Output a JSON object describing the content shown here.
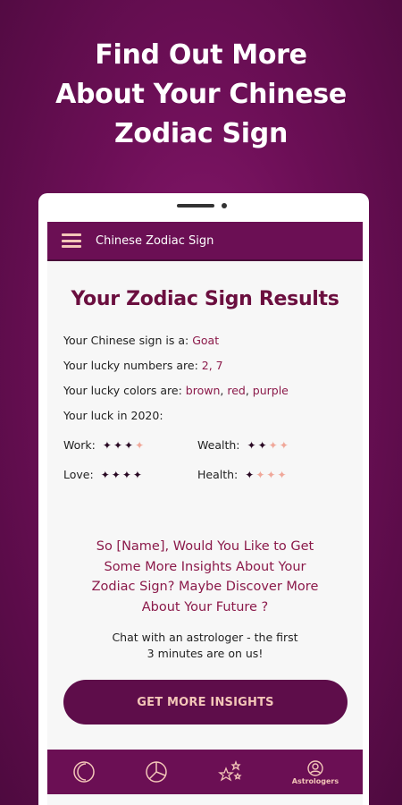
{
  "promo": {
    "title_line1": "Find Out More",
    "title_line2": "About Your Chinese",
    "title_line3": "Zodiac Sign"
  },
  "header": {
    "title": "Chinese Zodiac Sign",
    "menu_icon": "hamburger-icon"
  },
  "results": {
    "title": "Your Zodiac Sign Results",
    "sign_label": "Your Chinese sign is a:",
    "sign_value": "Goat",
    "numbers_label": "Your lucky numbers are:",
    "numbers_value": "2, 7",
    "colors_label": "Your lucky colors are:",
    "colors": [
      "brown",
      "red",
      "purple"
    ],
    "luck_label": "Your luck in 2020:",
    "luck": [
      {
        "label": "Work:",
        "rating": 3,
        "max": 4
      },
      {
        "label": "Wealth:",
        "rating": 2,
        "max": 4
      },
      {
        "label": "Love:",
        "rating": 4,
        "max": 4
      },
      {
        "label": "Health:",
        "rating": 1,
        "max": 4
      }
    ]
  },
  "cta": {
    "line1": "So [Name], Would You Like to Get",
    "line2": "Some More Insights About Your",
    "line3": "Zodiac Sign? Maybe Discover More",
    "line4": "About Your Future ?",
    "chat_line1": "Chat with an astrologer - the first",
    "chat_line2": "3 minutes are on us!",
    "button_label": "GET MORE INSIGHTS"
  },
  "bottom_nav": {
    "items": [
      {
        "icon": "moon-icon",
        "label": ""
      },
      {
        "icon": "chart-icon",
        "label": ""
      },
      {
        "icon": "stars-icon",
        "label": ""
      },
      {
        "icon": "user-icon",
        "label": "Astrologers"
      }
    ]
  },
  "colors": {
    "brand": "#6b0f54",
    "accent": "#f3c6b8",
    "value_text": "#8b1a4a"
  }
}
